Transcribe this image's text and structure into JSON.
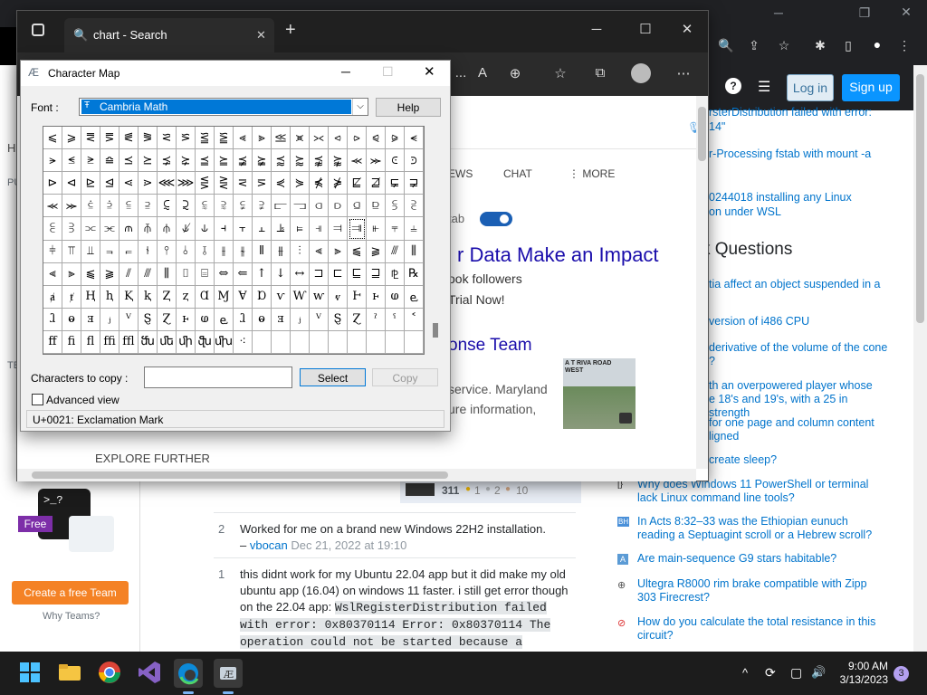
{
  "chrome": {
    "buttons": [
      "🔍",
      "⇪",
      "☆",
      "✱",
      "▯",
      "●",
      "⋮"
    ]
  },
  "so": {
    "login": "Log in",
    "signup": "Sign up",
    "hnq_top": [
      "rsterDistribution failed with error:",
      "14\"",
      "r-Processing fstab with mount -a",
      "0244018 installing any Linux",
      "on under WSL"
    ],
    "hnq_heading": "k Questions",
    "hnq": [
      "tia affect an object suspended in a",
      "version of i486 CPU",
      "derivative of the volume of the cone",
      "?",
      "th an overpowered player whose",
      "e 18's and 19's, with a 25 in strength",
      "for one page and column content",
      "ligned",
      "create sleep?"
    ],
    "hnq_bottom": [
      {
        "icon": "[}",
        "text": "Why does Windows 11 PowerShell or terminal lack Linux command line tools?"
      },
      {
        "icon": "BH",
        "text": "In Acts 8:32–33 was the Ethiopian eunuch reading a Septuagint scroll or a Hebrew scroll?"
      },
      {
        "icon": "A",
        "text": "Are main-sequence G9 stars habitable?"
      },
      {
        "icon": "⊕",
        "text": "Ultegra R8000 rim brake compatible with Zipp 303 Firecrest?"
      },
      {
        "icon": "⊘",
        "text": "How do you calculate the total resistance in this circuit?"
      }
    ],
    "left": {
      "h": "H",
      "pu": "PU",
      "te": "TE",
      "free": "Free",
      "create_team": "Create a free Team",
      "why_teams": "Why Teams?"
    },
    "user": {
      "rep": "311",
      "b1": "1",
      "b2": "2",
      "b3": "10"
    },
    "answers": [
      {
        "votes": "2",
        "text": "Worked for me on a brand new Windows 22H2 installation.",
        "by": "– ",
        "user": "vbocan",
        "date": " Dec 21, 2022 at 19:10"
      },
      {
        "votes": "1",
        "text": "this didnt work for my Ubuntu 22.04 app but it did make my old ubuntu app (16.04) on windows 11 faster. i still get error though on the 22.04 app: ",
        "code": "WslRegisterDistribution failed with error: 0x80370114 Error: 0x80370114 The operation could not be started because a"
      }
    ]
  },
  "edge": {
    "tab_title": "chart - Search",
    "tab_close": "✕",
    "new_tab": "+",
    "min": "─",
    "max": "☐",
    "close": "✕",
    "toolbar": [
      "...",
      "A",
      "⊕",
      "☆",
      "⧉",
      "●",
      "⋯"
    ],
    "bing": {
      "tabs": [
        "EWS",
        "CHAT",
        "⋮ MORE"
      ],
      "toggle_label": "tab",
      "ad_title": "r Data Make an Impact",
      "ad_line1": "ook followers",
      "ad_line2": "Trial Now!",
      "team_title": "onse Team",
      "service": "service. Maryland",
      "more_info": "ure information,",
      "thumb_text": "A T RIVA ROAD WEST",
      "explore": "EXPLORE FURTHER"
    }
  },
  "charmap": {
    "title": "Character Map",
    "font_label": "Font :",
    "font_value": "Cambria Math",
    "help": "Help",
    "rows": [
      [
        "⩽",
        "⩾",
        "⪙",
        "⪚",
        "⪛",
        "⪜",
        "⪝",
        "⪞",
        "⪟",
        "⪠",
        "⪡",
        "⪢",
        "⪣",
        "⪤",
        "⪥",
        "⪦",
        "⪧",
        "⪨",
        "⪩",
        "⪪"
      ],
      [
        "⪫",
        "⪬",
        "⪭",
        "⪮",
        "⪯",
        "⪰",
        "⪱",
        "⪲",
        "⪳",
        "⪴",
        "⪵",
        "⪶",
        "⪷",
        "⪸",
        "⪹",
        "⪺",
        "⪻",
        "⪼",
        "⪽",
        "⪾"
      ],
      [
        "⊳",
        "⊲",
        "⊵",
        "⊴",
        "⋖",
        "⋗",
        "⋘",
        "⋙",
        "⋚",
        "⋛",
        "⋜",
        "⋝",
        "⋞",
        "⋟",
        "⋠",
        "⋡",
        "⋢",
        "⋣",
        "⋤",
        "⋥"
      ],
      [
        "⪻",
        "⪼",
        "⫃",
        "⫄",
        "⫅",
        "⫆",
        "⫇",
        "⫈",
        "⫉",
        "⫊",
        "⫋",
        "⫌",
        "⫍",
        "⫎",
        "⫏",
        "⫐",
        "⫑",
        "⫒",
        "⫓",
        "⫔"
      ],
      [
        "⫕",
        "⫖",
        "⫗",
        "⫘",
        "⫙",
        "⫚",
        "⫛",
        "⫝̸",
        "⫝",
        "⫞",
        "⫟",
        "⫠",
        "⫡",
        "⫢",
        "⫣",
        "⫤",
        "⫥",
        "⫦",
        "⫧",
        "⫨"
      ],
      [
        "⫩",
        "⫪",
        "⫫",
        "⫬",
        "⫭",
        "⫮",
        "⫯",
        "⫰",
        "⫱",
        "⫲",
        "⫳",
        "⫴",
        "⫵",
        "⫶",
        "⫷",
        "⫸",
        "⫹",
        "⫺",
        "⫻",
        "⫼"
      ],
      [
        "⫷",
        "⫸",
        "⫹",
        "⫺",
        "⫽",
        "⫻",
        "⫼",
        "⌷",
        "⌸",
        "⇔",
        "⇐",
        "↑",
        "↓",
        "↔",
        "⊐",
        "⊏",
        "⊑",
        "⊒",
        "⅊",
        "℞"
      ],
      [
        "ⱥ",
        "ⱦ",
        "Ⱨ",
        "ⱨ",
        "Ⱪ",
        "ⱪ",
        "Ⱬ",
        "ⱬ",
        "Ɑ",
        "Ɱ",
        "Ɐ",
        "Ɒ",
        "ⱱ",
        "Ⱳ",
        "ⱳ",
        "ⱴ",
        "Ⱶ",
        "ⱶ",
        "ⱷ",
        "ⱸ"
      ],
      [
        "ⱹ",
        "ⱺ",
        "ⱻ",
        "ⱼ",
        "ⱽ",
        "Ȿ",
        "Ɀ",
        "ⱶ",
        "ⱷ",
        "ⱸ",
        "ⱹ",
        "ⱺ",
        "ⱻ",
        "ⱼ",
        "ⱽ",
        "Ȿ",
        "Ɀ",
        "ˀ",
        "ˁ",
        "˂"
      ],
      [
        "ﬀ",
        "ﬁ",
        "ﬂ",
        "ﬃ",
        "ﬄ",
        "ﬓ",
        "ﬔ",
        "ﬕ",
        "ﬖ",
        "ﬗ",
        "⁖",
        "",
        "",
        "",
        "",
        "",
        "",
        "",
        "",
        ""
      ]
    ],
    "copy_label": "Characters to copy :",
    "copy_value": "",
    "select": "Select",
    "copy": "Copy",
    "advanced": "Advanced view",
    "status": "U+0021: Exclamation Mark"
  },
  "taskbar": {
    "time": "9:00 AM",
    "date": "3/13/2023",
    "badge": "3",
    "tray": [
      "^",
      "⟳",
      "▢",
      "🔊"
    ]
  }
}
